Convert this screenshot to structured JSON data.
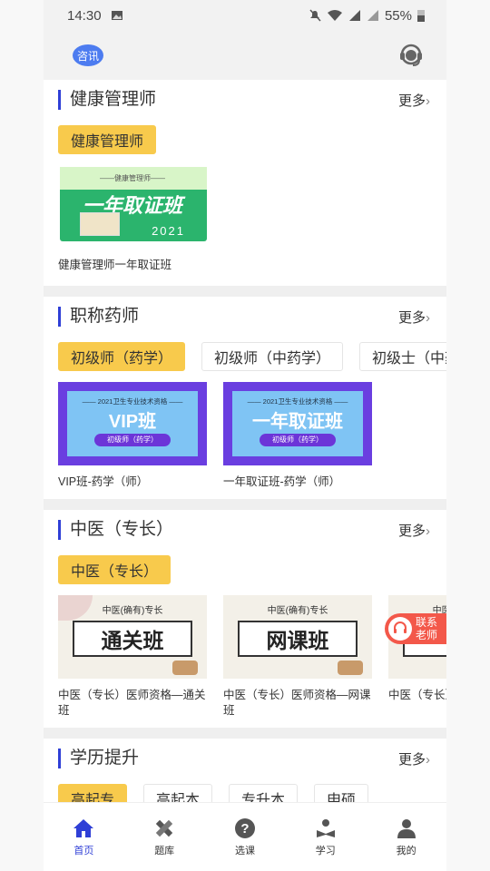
{
  "status": {
    "time": "14:30",
    "battery": "55%"
  },
  "topbar": {
    "news_label": "咨讯"
  },
  "sections": [
    {
      "title": "健康管理师",
      "more": "更多",
      "chips": [
        "健康管理师"
      ],
      "cards": [
        {
          "kicker": "——健康管理师——",
          "headline": "一年取证班",
          "year": "2021",
          "caption": "健康管理师一年取证班"
        }
      ]
    },
    {
      "title": "职称药师",
      "more": "更多",
      "chips": [
        "初级师（药学）",
        "初级师（中药学）",
        "初级士（中药"
      ],
      "cards": [
        {
          "kicker": "—— 2021卫生专业技术资格 ——",
          "headline": "VIP班",
          "pill": "初级师（药学）",
          "caption": "VIP班-药学（师）"
        },
        {
          "kicker": "—— 2021卫生专业技术资格 ——",
          "headline": "一年取证班",
          "pill": "初级师（药学）",
          "caption": "一年取证班-药学（师）"
        }
      ]
    },
    {
      "title": "中医（专长）",
      "more": "更多",
      "chips": [
        "中医（专长）"
      ],
      "cards": [
        {
          "kicker": "中医(确有)专长",
          "headline": "通关班",
          "caption": "中医（专长）医师资格—通关班"
        },
        {
          "kicker": "中医(确有)专长",
          "headline": "网课班",
          "caption": "中医（专长）医师资格—网课班"
        },
        {
          "kicker": "中医(确有)专长",
          "headline": "网",
          "caption": "中医（专长）班"
        }
      ]
    },
    {
      "title": "学历提升",
      "more": "更多",
      "chips": [
        "高起专",
        "高起本",
        "专升本",
        "申硕"
      ]
    }
  ],
  "float_contact": {
    "line1": "联系",
    "line2": "老师"
  },
  "tabs": [
    {
      "label": "首页",
      "icon": "home-icon",
      "active": true
    },
    {
      "label": "题库",
      "icon": "pencil-ruler-icon",
      "active": false
    },
    {
      "label": "选课",
      "icon": "question-icon",
      "active": false
    },
    {
      "label": "学习",
      "icon": "study-icon",
      "active": false
    },
    {
      "label": "我的",
      "icon": "user-icon",
      "active": false
    }
  ],
  "colors": {
    "accent": "#2f3fd6",
    "chip_active": "#f8ca4c",
    "float": "#f3584a"
  }
}
